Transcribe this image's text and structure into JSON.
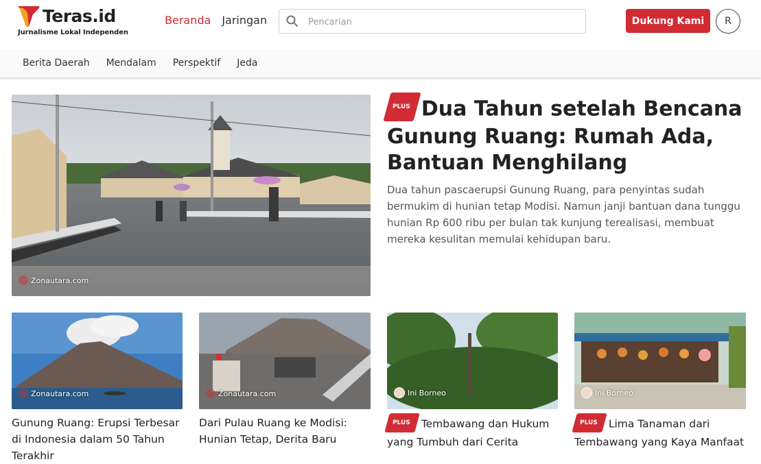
{
  "brand": {
    "name": "Teras.id",
    "tagline": "Jurnalisme Lokal Independen",
    "accent": "#d22b34"
  },
  "main_nav": [
    {
      "label": "Beranda",
      "active": true
    },
    {
      "label": "Jaringan",
      "active": false
    }
  ],
  "search": {
    "placeholder": "Pencarian",
    "value": "",
    "icon": "search-icon"
  },
  "support_button": {
    "label": "Dukung Kami"
  },
  "user": {
    "initial": "R"
  },
  "sub_nav": [
    "Berita Daerah",
    "Mendalam",
    "Perspektif",
    "Jeda"
  ],
  "hero": {
    "badge": "PLUS",
    "title": "Dua Tahun setelah Bencana Gunung Ruang: Rumah Ada, Bantuan Menghilang",
    "description": "Dua tahun pascaerupsi Gunung Ruang, para penyintas sudah bermukim di hunian tetap Modisi. Namun janji bantuan dana tunggu hunian Rp 600 ribu per bulan tak kunjung terealisasi, membuat mereka kesulitan memulai kehidupan baru.",
    "credit": "Zonautara.com"
  },
  "cards": [
    {
      "credit": "Zonautara.com",
      "badge": "",
      "title": "Gunung Ruang: Erupsi Terbesar di Indonesia dalam 50 Tahun Terakhir"
    },
    {
      "credit": "Zonautara.com",
      "badge": "",
      "title": "Dari Pulau Ruang ke Modisi: Hunian Tetap, Derita Baru"
    },
    {
      "credit": "Ini Borneo",
      "badge": "PLUS",
      "title": "Tembawang dan Hukum yang Tumbuh dari Cerita"
    },
    {
      "credit": "Ini Borneo",
      "badge": "PLUS",
      "title": "Lima Tanaman dari Tembawang yang Kaya Manfaat"
    }
  ]
}
